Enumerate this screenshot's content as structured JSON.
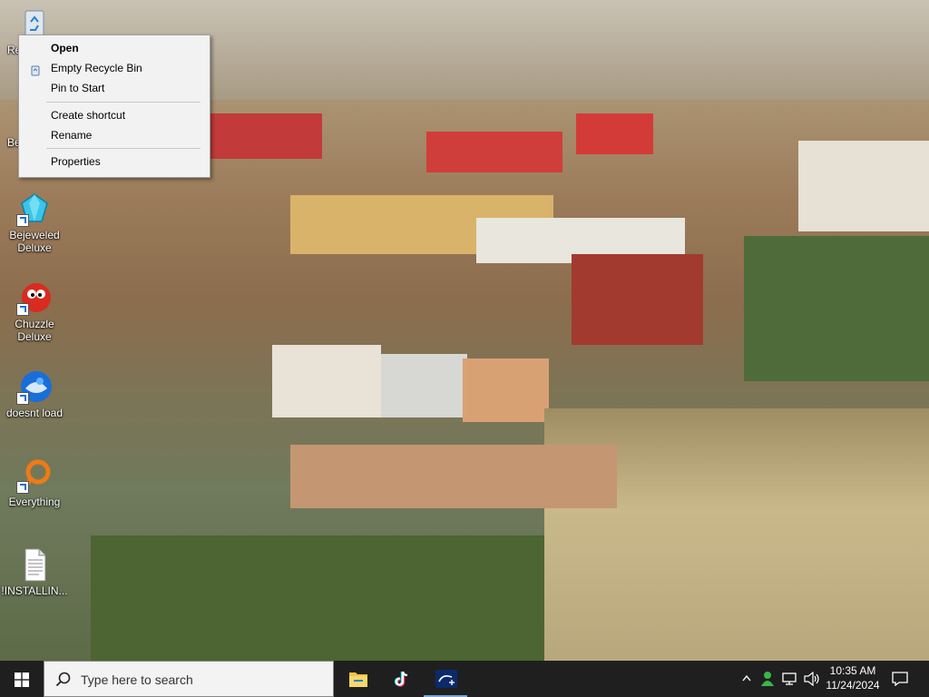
{
  "desktop": {
    "icons": [
      {
        "label": "Re"
      },
      {
        "label": "Be"
      },
      {
        "label": "Bejeweled Deluxe"
      },
      {
        "label": "Chuzzle Deluxe"
      },
      {
        "label": "doesnt load"
      },
      {
        "label": "Everything"
      },
      {
        "label": "!INSTALLIN..."
      }
    ]
  },
  "context_menu": {
    "items": [
      {
        "label": "Open",
        "bold": true
      },
      {
        "label": "Empty Recycle Bin"
      },
      {
        "label": "Pin to Start"
      },
      {
        "label": "Create shortcut"
      },
      {
        "label": "Rename"
      },
      {
        "label": "Properties"
      }
    ]
  },
  "taskbar": {
    "search_placeholder": "Type here to search",
    "clock": {
      "time": "10:35 AM",
      "date": "11/24/2024"
    }
  },
  "colors": {
    "taskbar_bg": "#1f1f1f",
    "menu_bg": "#f2f2f2",
    "accent": "#1e6fd6"
  }
}
